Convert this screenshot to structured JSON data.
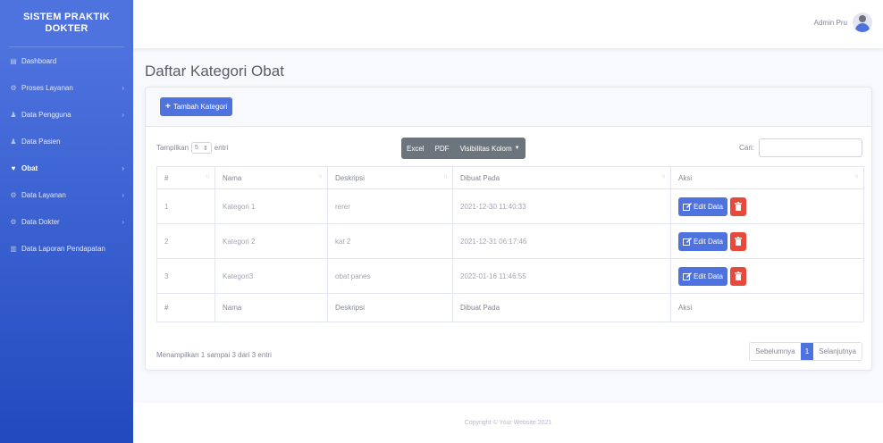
{
  "brand": {
    "line1": "SISTEM PRAKTIK",
    "line2": "DOKTER"
  },
  "sidebar": {
    "items": [
      {
        "label": "Dashboard",
        "icon": "dashboard-icon",
        "glyph": "▤",
        "has_chevron": false,
        "active": false
      },
      {
        "label": "Proses Layanan",
        "icon": "gear-icon",
        "glyph": "⚙",
        "has_chevron": true,
        "active": false
      },
      {
        "label": "Data Pengguna",
        "icon": "user-icon",
        "glyph": "♟",
        "has_chevron": true,
        "active": false
      },
      {
        "label": "Data Pasien",
        "icon": "user-icon",
        "glyph": "♟",
        "has_chevron": false,
        "active": false
      },
      {
        "label": "Obat",
        "icon": "heart-icon",
        "glyph": "♥",
        "has_chevron": true,
        "active": true
      },
      {
        "label": "Data Layanan",
        "icon": "gear-icon",
        "glyph": "⚙",
        "has_chevron": true,
        "active": false
      },
      {
        "label": "Data Dokter",
        "icon": "gear-icon",
        "glyph": "⚙",
        "has_chevron": true,
        "active": false
      },
      {
        "label": "Data Laporan Pendapatan",
        "icon": "chart-icon",
        "glyph": "▥",
        "has_chevron": false,
        "active": false
      }
    ]
  },
  "topbar": {
    "user_name": "Admin Pru"
  },
  "page": {
    "title": "Daftar Kategori Obat"
  },
  "toolbar": {
    "add_label": "Tambah Kategori"
  },
  "table_controls": {
    "show_prefix": "Tampilkan",
    "show_value": "5",
    "show_suffix": "entri",
    "export_excel": "Excel",
    "export_pdf": "PDF",
    "column_visibility": "Visibilitas Kolom",
    "search_label": "Cari:",
    "search_value": ""
  },
  "table": {
    "headers": [
      "#",
      "Nama",
      "Deskripsi",
      "Dibuat Pada",
      "Aksi"
    ],
    "rows": [
      [
        "1",
        "Kategori 1",
        "rerer",
        "2021-12-30 11:40:33"
      ],
      [
        "2",
        "Kategori 2",
        "kat 2",
        "2021-12-31 06:17:46"
      ],
      [
        "3",
        "Kategori3",
        "obat panes",
        "2022-01-16 11:46:55"
      ]
    ],
    "edit_label": "Edit Data"
  },
  "pagination": {
    "info": "Menampilkan 1 sampai 3 dari 3 entri",
    "prev": "Sebelumnya",
    "current": "1",
    "next": "Selanjutnya"
  },
  "footer": {
    "copyright": "Copyright © Your Website 2021"
  },
  "colors": {
    "primary": "#4e73df",
    "danger": "#e74a3b",
    "secondary": "#6c757d"
  }
}
